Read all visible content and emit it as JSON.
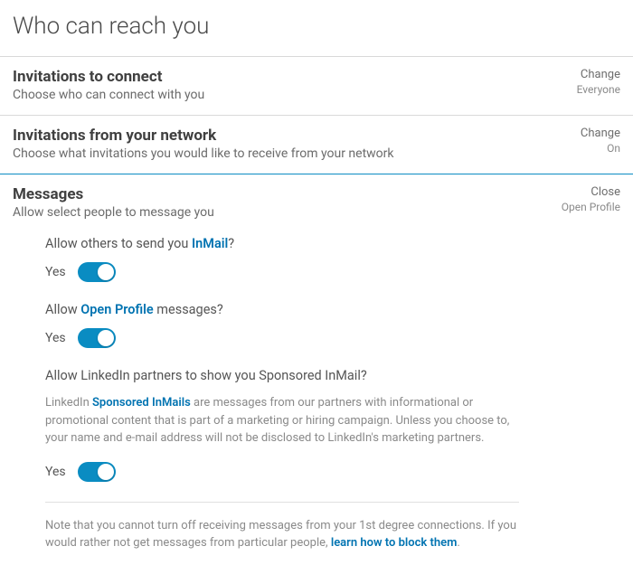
{
  "page_title": "Who can reach you",
  "sections": {
    "invitations": {
      "title": "Invitations to connect",
      "desc": "Choose who can connect with you",
      "action": "Change",
      "status": "Everyone"
    },
    "network": {
      "title": "Invitations from your network",
      "desc": "Choose what invitations you would like to receive from your network",
      "action": "Change",
      "status": "On"
    },
    "messages": {
      "title": "Messages",
      "desc": "Allow select people to message you",
      "action": "Close",
      "status": "Open Profile",
      "q1_prefix": "Allow others to send you ",
      "q1_link": "InMail",
      "q1_suffix": "?",
      "q2_prefix": "Allow ",
      "q2_link": "Open Profile",
      "q2_suffix": " messages?",
      "q3": "Allow LinkedIn partners to show you Sponsored InMail?",
      "info_prefix": "LinkedIn ",
      "info_link": "Sponsored InMails",
      "info_suffix": " are messages from our partners with informational or promotional content that is part of a marketing or hiring campaign. Unless you choose to, your name and e-mail address will not be disclosed to LinkedIn's marketing partners.",
      "toggle_label": "Yes",
      "note_prefix": "Note that you cannot turn off receiving messages from your 1st degree connections. If you would rather not get messages from particular people, ",
      "note_link": "learn how to block them",
      "note_suffix": "."
    }
  }
}
